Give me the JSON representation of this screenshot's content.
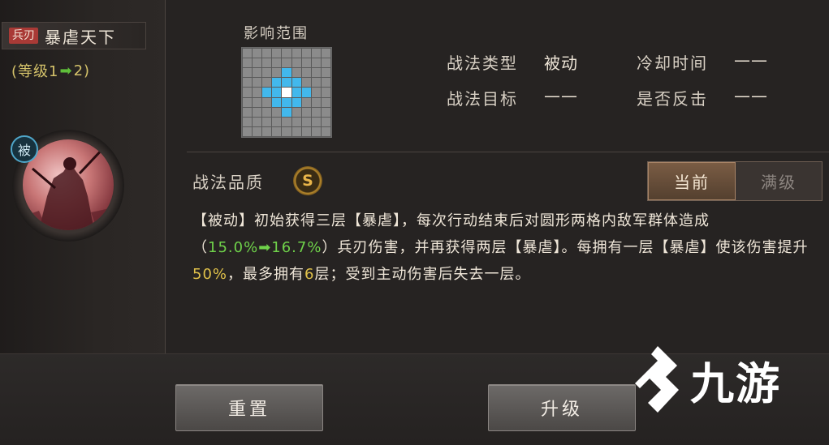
{
  "skill": {
    "type_badge": "兵刃",
    "name": "暴虐天下",
    "level_prefix": "(等级1",
    "level_arrow": "➡",
    "level_suffix": "2)",
    "passive_badge": "被"
  },
  "range": {
    "title": "影响范围",
    "grid_size": 9,
    "hit_cells": [
      [
        2,
        4
      ],
      [
        3,
        3
      ],
      [
        3,
        4
      ],
      [
        3,
        5
      ],
      [
        4,
        2
      ],
      [
        4,
        3
      ],
      [
        4,
        5
      ],
      [
        4,
        6
      ],
      [
        5,
        3
      ],
      [
        5,
        4
      ],
      [
        5,
        5
      ],
      [
        6,
        4
      ]
    ],
    "center_cell": [
      4,
      4
    ]
  },
  "info": {
    "type_label": "战法类型",
    "type_value": "被动",
    "cooldown_label": "冷却时间",
    "cooldown_value": "——",
    "target_label": "战法目标",
    "target_value": "——",
    "counter_label": "是否反击",
    "counter_value": "——"
  },
  "quality": {
    "label": "战法品质",
    "grade": "S"
  },
  "toggle": {
    "current": "当前",
    "max": "满级",
    "selected": "current"
  },
  "description": {
    "p1": "【被动】初始获得三层【暴虐】，每次行动结束后对圆形两格内敌军群体造成（",
    "dmg_from": "15.0%",
    "arrow": "➡",
    "dmg_to": "16.7%",
    "p2": "）兵刃伤害，并再获得两层【暴虐】。每拥有一层【暴虐】使该伤害提升",
    "boost": "50%",
    "p3": "，最多拥有",
    "max_stacks": "6",
    "p4": "层；受到主动伤害后失去一层。"
  },
  "buttons": {
    "reset": "重置",
    "upgrade": "升级"
  },
  "watermark": {
    "text": "九游"
  },
  "colors": {
    "accent_gold": "#e0c14a",
    "accent_green": "#6fd24a",
    "range_hit": "#42b8ec",
    "badge_red": "#a93a36"
  }
}
